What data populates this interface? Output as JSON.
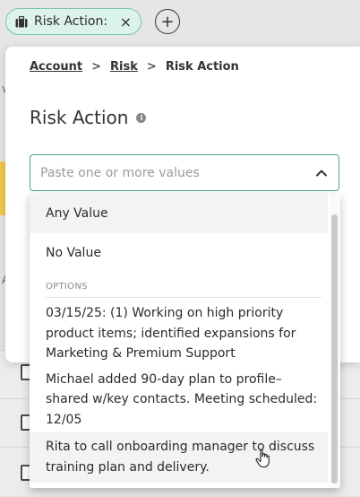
{
  "background": {
    "left_letters": [
      "v",
      "A"
    ]
  },
  "filter_pill": {
    "label": "Risk Action:",
    "close_glyph": "×",
    "icon": "briefcase-icon"
  },
  "add_button": {
    "glyph": "+"
  },
  "breadcrumb": {
    "items": [
      "Account",
      "Risk",
      "Risk Action"
    ],
    "separator": ">"
  },
  "panel": {
    "title": "Risk Action",
    "info_glyph": "i"
  },
  "search": {
    "placeholder": "Paste one or more values",
    "value": ""
  },
  "dropdown": {
    "fixed_options": [
      "Any Value",
      "No Value"
    ],
    "section_header": "OPTIONS",
    "options": [
      "03/15/25: (1) Working on high priority product items; identified expansions for Marketing & Premium Support",
      "Michael added 90-day plan to profile–shared w/key contacts. Meeting scheduled: 12/05",
      "Rita to call onboarding manager to discuss training plan and delivery."
    ]
  },
  "colors": {
    "accent": "#52a58c",
    "pill_bg": "#dcf3ea",
    "pill_border": "#7cc3ad"
  }
}
